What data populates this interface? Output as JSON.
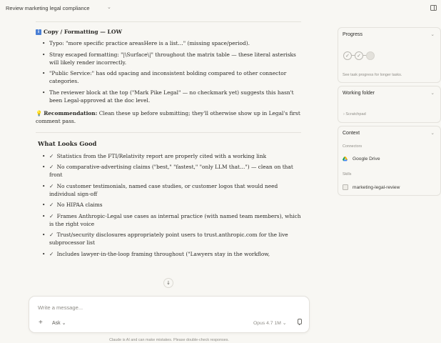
{
  "topbar": {
    "title": "Review marketing legal compliance",
    "title_chevron": "⌄",
    "panel_icon": "panel-toggle-icon"
  },
  "chat": {
    "copy_section": {
      "icon_text": "i",
      "heading": "Copy / Formatting — LOW",
      "bullets": [
        "Typo: \"more specific practice areasHere is a list…\" (missing space/period).",
        "Stray escaped formatting: \"|\\Surface\\|\" throughout the matrix table — these literal asterisks will likely render incorrectly.",
        "\"Public Service:\" has odd spacing and inconsistent bolding compared to other connector categories.",
        "The reviewer block at the top (\"Mark Pike Legal\" — no checkmark yet) suggests this hasn't been Legal-approved at the doc level."
      ],
      "recommendation_label": "Recommendation:",
      "recommendation_text": " Clean these up before submitting; they'll otherwise show up in Legal's first comment pass."
    },
    "good_section": {
      "heading": "What Looks Good",
      "check": "✓",
      "bullets": [
        "Statistics from the FTI/Relativity report are properly cited with a working link",
        "No comparative-advertising claims (\"best,\" \"fastest,\" \"only LLM that…\") — clean on that front",
        "No customer testimonials, named case studies, or customer logos that would need individual sign-off",
        "No HIPAA claims",
        "Frames Anthropic-Legal use cases as internal practice (with named team members), which is the right voice",
        "Trust/security disclosures appropriately point users to trust.anthropic.com for the live subprocessor list",
        "Includes lawyer-in-the-loop framing throughout (\"Lawyers stay in the workflow,"
      ]
    },
    "scroll_down": "↓"
  },
  "composer": {
    "placeholder": "Write a message...",
    "plus": "+",
    "mode": "Ask ⌄",
    "model": "Opus 4.7 1M ⌄"
  },
  "disclaimer": "Claude is AI and can make mistakes. Please double-check responses.",
  "sidebar": {
    "progress": {
      "title": "Progress",
      "chevron": "⌄",
      "steps": [
        "✓",
        "✓",
        ""
      ],
      "hint": "See task progress for longer tasks."
    },
    "working_folder": {
      "title": "Working folder",
      "chevron": "⌄",
      "item": "› Scratchpad"
    },
    "context": {
      "title": "Context",
      "chevron": "⌄",
      "connectors_label": "Connectors",
      "connector": "Google Drive",
      "skills_label": "Skills",
      "skill": "marketing-legal-review"
    }
  },
  "colors": {
    "background": "#f8f7f3",
    "card_border": "#e4e2dc",
    "info_badge": "#4a7fd4",
    "bulb": "#e2b43a"
  }
}
